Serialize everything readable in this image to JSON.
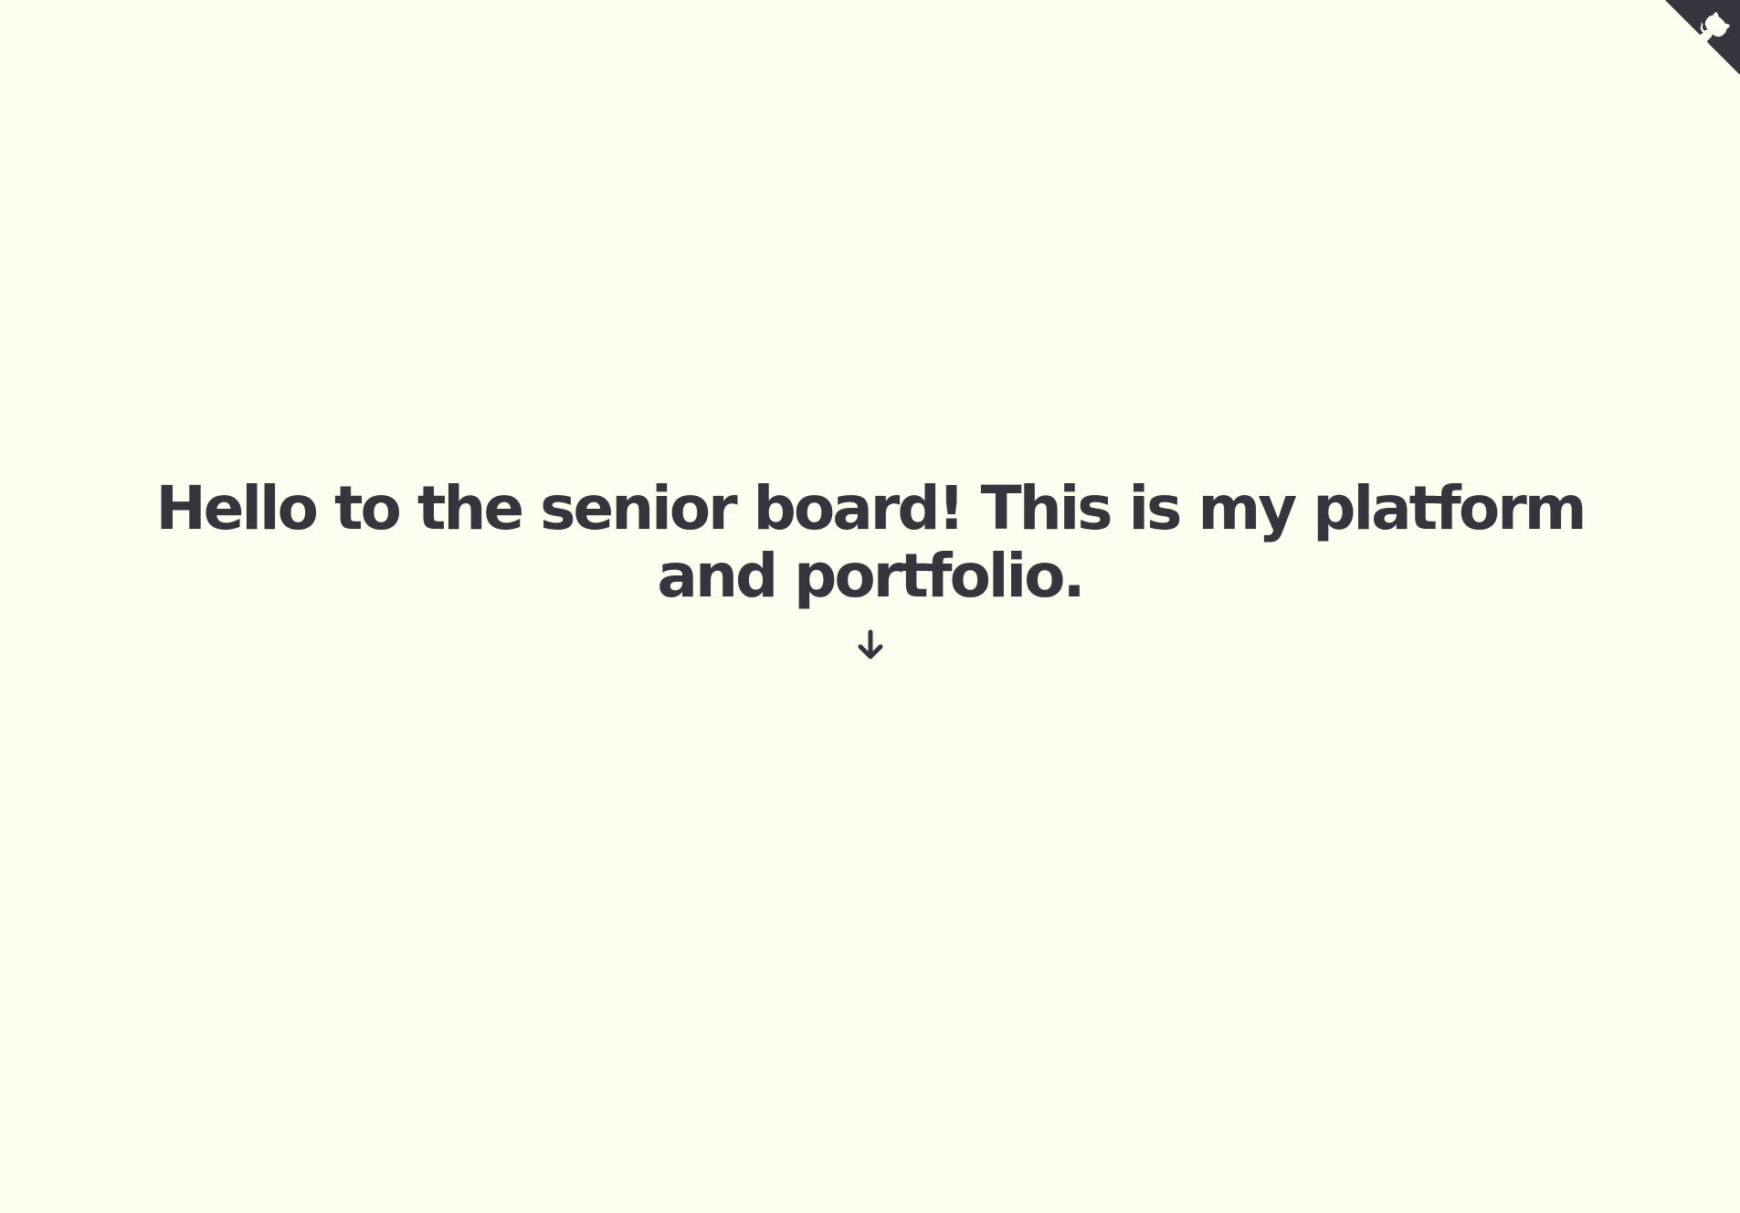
{
  "hero": {
    "heading": "Hello to the senior board! This is my platform and portfolio."
  },
  "scroll_down": {
    "icon": "arrow-down-icon"
  },
  "corner_link": {
    "icon": "github-octocat-icon",
    "color": "#35353d"
  },
  "colors": {
    "background": "#fdfdf0",
    "text": "#35353d"
  }
}
